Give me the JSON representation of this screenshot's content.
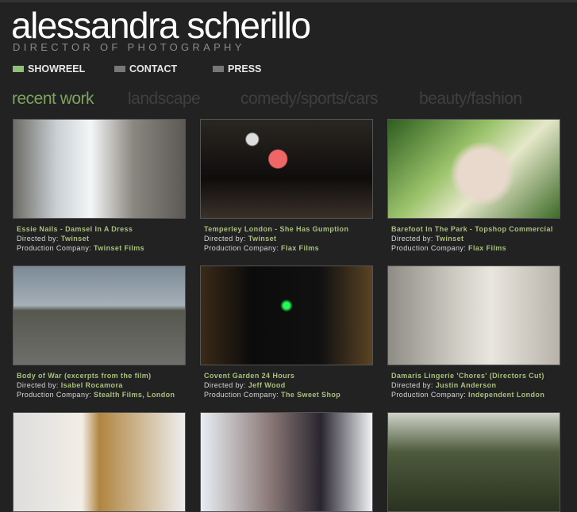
{
  "header": {
    "name": "alessandra scherillo",
    "subtitle": "DIRECTOR OF PHOTOGRAPHY"
  },
  "nav": [
    {
      "label": "SHOWREEL",
      "color": "#8fbf78"
    },
    {
      "label": "CONTACT"
    },
    {
      "label": "PRESS"
    }
  ],
  "tabs": [
    "recent work",
    "landscape",
    "comedy/sports/cars",
    "beauty/fashion"
  ],
  "labels": {
    "directed": "Directed by: ",
    "production": "Production Company: "
  },
  "works": [
    {
      "title": "Essie Nails - Damsel In A Dress",
      "director": "Twinset",
      "company": "Twinset Films"
    },
    {
      "title": "Temperley London - She Has Gumption",
      "director": "Twinset",
      "company": "Flax Films"
    },
    {
      "title": "Barefoot In The Park - Topshop Commercial",
      "director": "Twinset",
      "company": "Flax Films"
    },
    {
      "title": "Body of War (excerpts from the film)",
      "director": "Isabel Rocamora",
      "company": "Stealth Films, London"
    },
    {
      "title": "Covent Garden 24 Hours",
      "director": "Jeff Wood",
      "company": "The Sweet Shop"
    },
    {
      "title": "Damaris Lingerie 'Chores' (Directors Cut)",
      "director": "Justin Anderson",
      "company": "Independent London"
    }
  ]
}
